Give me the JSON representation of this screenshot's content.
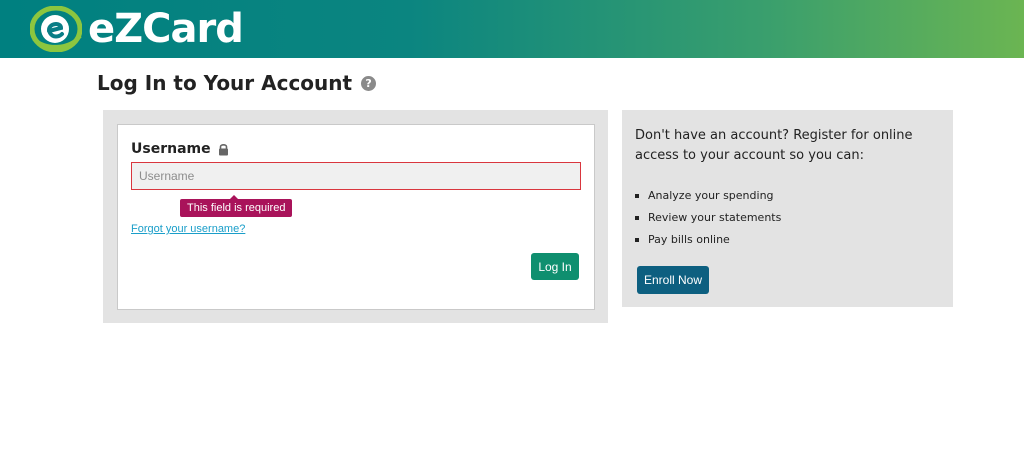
{
  "header": {
    "brand_name": "eZCard",
    "logo_icon": "ezcard-e-logo-icon",
    "gradient_colors": [
      "#008080",
      "#6bb552"
    ]
  },
  "page": {
    "title": "Log In to Your Account",
    "help_icon": "question-circle-icon"
  },
  "login": {
    "username_label": "Username",
    "lock_icon": "lock-icon",
    "username_placeholder": "Username",
    "username_value": "",
    "error_message": "This field is required",
    "forgot_link": "Forgot your username?",
    "login_button": "Log In"
  },
  "enroll": {
    "intro": "Don't have an account? Register for online access to your account so you can:",
    "benefits": [
      "Analyze your spending",
      "Review your statements",
      "Pay bills online"
    ],
    "enroll_button": "Enroll Now"
  },
  "colors": {
    "primary_button": "#0f8f6f",
    "enroll_button": "#0d5f80",
    "error": "#a9135a",
    "link": "#1a9ec9"
  }
}
